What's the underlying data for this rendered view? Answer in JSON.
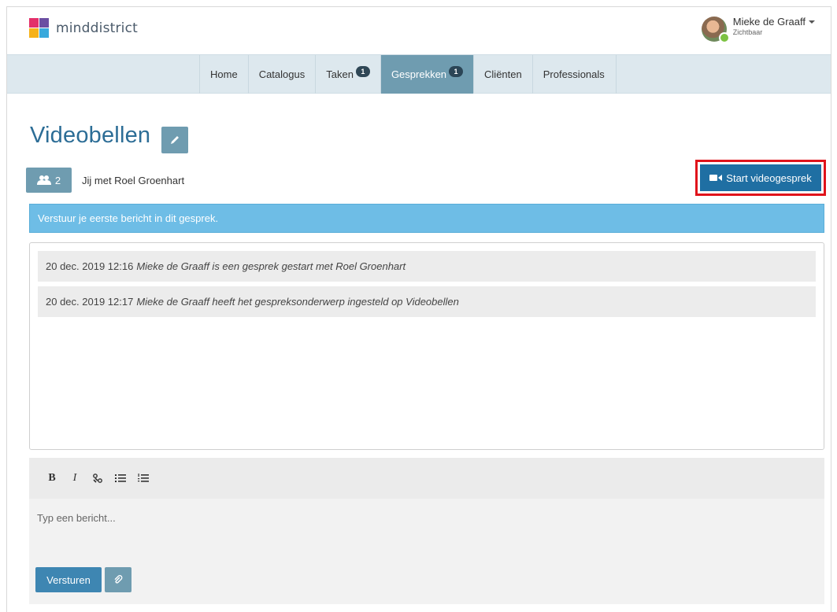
{
  "brand": {
    "name": "minddistrict"
  },
  "user": {
    "name": "Mieke de Graaff",
    "status": "Zichtbaar"
  },
  "nav": {
    "items": [
      {
        "label": "Home"
      },
      {
        "label": "Catalogus"
      },
      {
        "label": "Taken",
        "badge": "1"
      },
      {
        "label": "Gesprekken",
        "badge": "1",
        "active": true
      },
      {
        "label": "Cliënten"
      },
      {
        "label": "Professionals"
      }
    ]
  },
  "conversation": {
    "title": "Videobellen",
    "participant_count": "2",
    "participants_text": "Jij met Roel Groenhart",
    "start_video_label": "Start videogesprek",
    "info_banner": "Verstuur je eerste bericht in dit gesprek.",
    "messages": [
      {
        "time": "20 dec. 2019 12:16",
        "text": "Mieke de Graaff is een gesprek gestart met Roel Groenhart"
      },
      {
        "time": "20 dec. 2019 12:17",
        "text": "Mieke de Graaff heeft het gespreksonderwerp ingesteld op Videobellen"
      }
    ]
  },
  "composer": {
    "toolbar": {
      "bold": "B",
      "italic": "I"
    },
    "placeholder": "Typ een bericht...",
    "send_label": "Versturen"
  },
  "colors": {
    "accent": "#6f9cb0",
    "primary": "#1f6fa3",
    "title": "#2c6d96",
    "banner": "#6ebde6",
    "highlight": "#e0131b"
  },
  "icons": [
    "logo-icon",
    "user-avatar",
    "edit-pencil-icon",
    "users-icon",
    "video-camera-icon",
    "link-icon",
    "bullet-list-icon",
    "numbered-list-icon",
    "paperclip-icon"
  ]
}
